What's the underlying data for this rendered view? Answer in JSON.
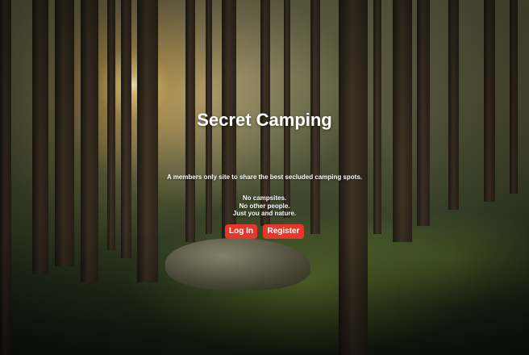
{
  "hero": {
    "title": "Secret Camping",
    "subtitle": "A members only site to share the best secluded camping spots.",
    "tagline": [
      "No campsites.",
      "No other people.",
      "Just you and nature."
    ]
  },
  "actions": {
    "login_label": "Log In",
    "register_label": "Register"
  },
  "colors": {
    "button_bg": "#e4382a",
    "text": "#ffffff"
  }
}
